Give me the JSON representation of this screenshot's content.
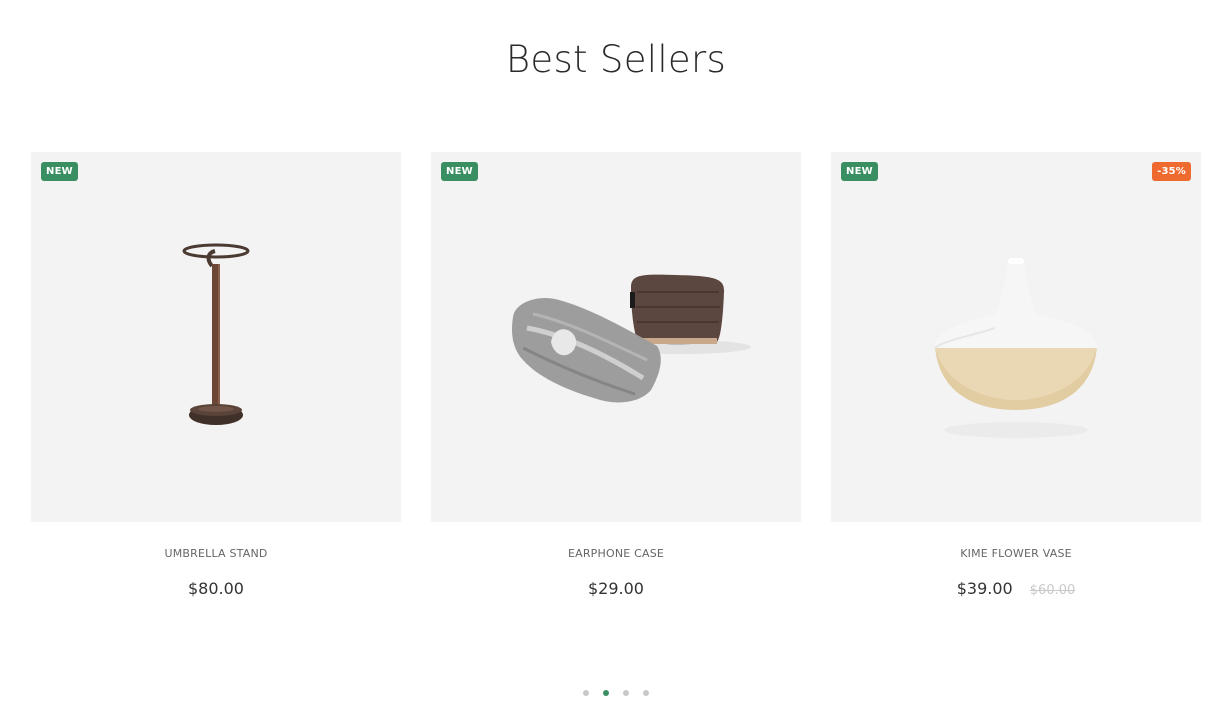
{
  "section": {
    "title": "Best Sellers"
  },
  "products": [
    {
      "name": "UMBRELLA STAND",
      "price": "$80.00",
      "old_price": "",
      "badge_new": "NEW",
      "badge_sale": "",
      "image_icon": "umbrella-stand-image"
    },
    {
      "name": "EARPHONE CASE",
      "price": "$29.00",
      "old_price": "",
      "badge_new": "NEW",
      "badge_sale": "",
      "image_icon": "earphone-case-image"
    },
    {
      "name": "KIME FLOWER VASE",
      "price": "$39.00",
      "old_price": "$60.00",
      "badge_new": "NEW",
      "badge_sale": "-35%",
      "image_icon": "flower-vase-image"
    }
  ],
  "pagination": {
    "count": 4,
    "active": 1
  },
  "colors": {
    "accent": "#3a8f62",
    "sale": "#ef6a2f",
    "card_bg": "#f3f3f3"
  }
}
